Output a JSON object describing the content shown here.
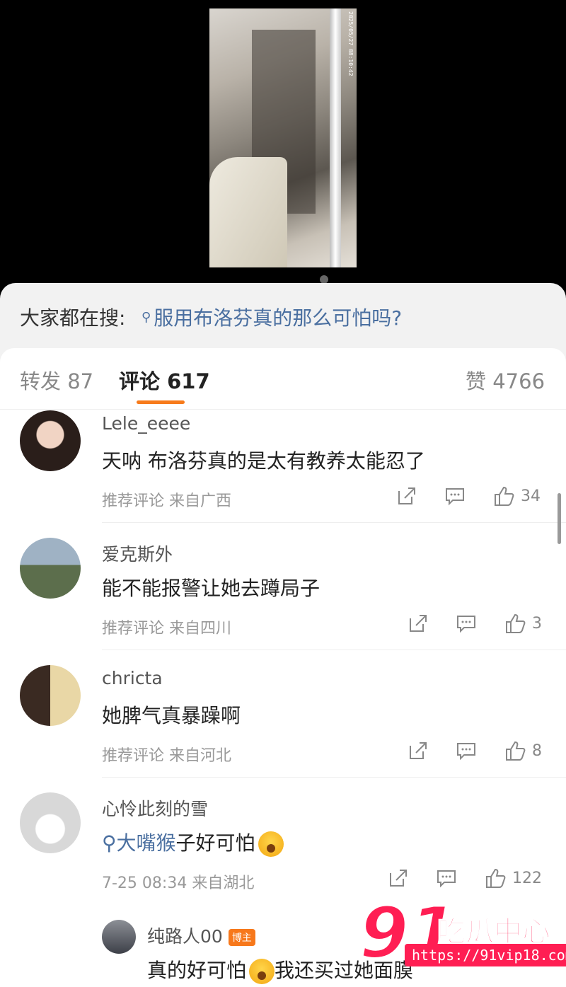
{
  "video": {
    "timestamp": "2025/05/27 08:10:42"
  },
  "search": {
    "prefix": "大家都在搜:",
    "query": "服用布洛芬真的那么可怕吗?"
  },
  "tabs": {
    "repost_label": "转发",
    "repost_count": "87",
    "comment_label": "评论",
    "comment_count": "617",
    "like_label": "赞",
    "like_count": "4766",
    "accent": "#f77b1b"
  },
  "comments": [
    {
      "user": "Lele_eeee",
      "text": "天呐 布洛芬真的是太有教养太能忍了",
      "tag": "推荐评论",
      "location": "来自广西",
      "likes": "34"
    },
    {
      "user": "爱克斯外",
      "text": "能不能报警让她去蹲局子",
      "tag": "推荐评论",
      "location": "来自四川",
      "likes": "3"
    },
    {
      "user": "chricta",
      "text": "她脾气真暴躁啊",
      "tag": "推荐评论",
      "location": "来自河北",
      "likes": "8"
    },
    {
      "user": "心怜此刻的雪",
      "search_text": "大嘴猴",
      "text": "子好可怕",
      "time": "7-25 08:34",
      "location": "来自湖北",
      "likes": "122"
    }
  ],
  "reply": {
    "user": "纯路人00",
    "badge": "博主",
    "text_a": "真的好可怕",
    "text_b": "我还买过她",
    "text_c": "面膜"
  },
  "watermark": {
    "number": "91",
    "title": "吃瓜中心",
    "url": "https://91vip18.com",
    "color": "#ff1e53"
  },
  "icons": [
    "share-icon",
    "comment-icon",
    "like-icon",
    "search-icon"
  ]
}
